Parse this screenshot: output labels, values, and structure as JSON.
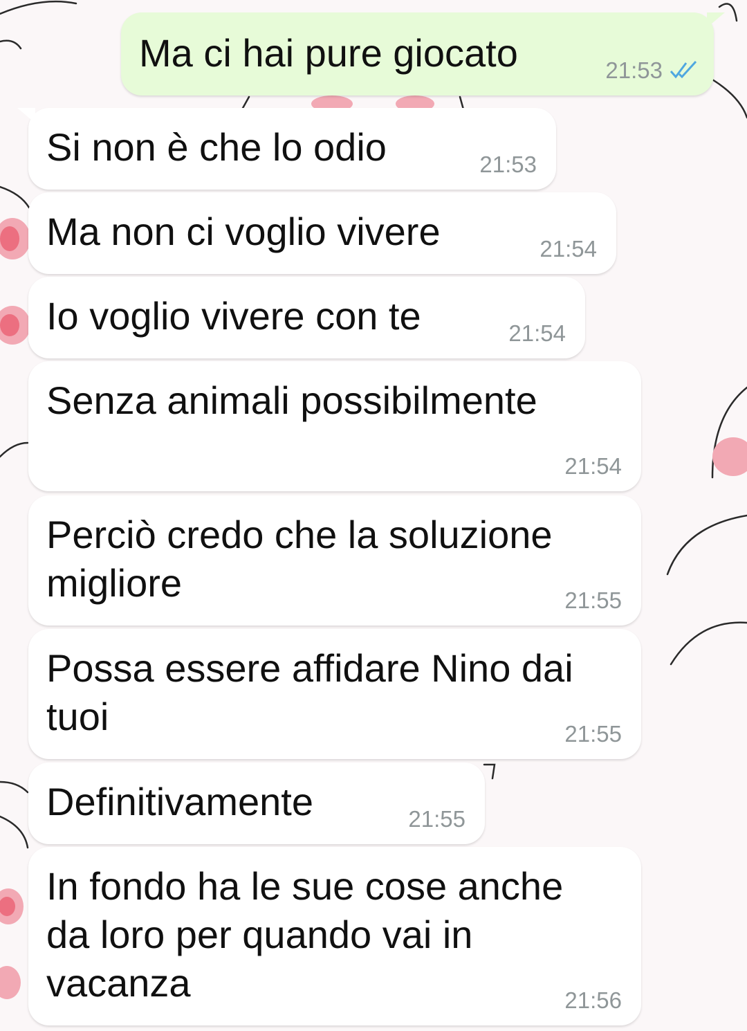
{
  "colors": {
    "incoming_bubble": "#ffffff",
    "outgoing_bubble": "#e7fbd8",
    "time_text": "#8f9698",
    "read_ticks": "#4fa7e0",
    "message_text": "#101010"
  },
  "messages": [
    {
      "direction": "outgoing",
      "text": "Ma ci hai pure giocato",
      "time": "21:53",
      "status": "read-ticks-icon"
    },
    {
      "direction": "incoming",
      "text": "Si non è che lo odio",
      "time": "21:53"
    },
    {
      "direction": "incoming",
      "text": "Ma non ci voglio vivere",
      "time": "21:54"
    },
    {
      "direction": "incoming",
      "text": "Io voglio vivere con te",
      "time": "21:54"
    },
    {
      "direction": "incoming",
      "text": "Senza animali possibilmente",
      "time": "21:54"
    },
    {
      "direction": "incoming",
      "lines": [
        "Perciò credo che la soluzione",
        "migliore"
      ],
      "time": "21:55"
    },
    {
      "direction": "incoming",
      "lines": [
        "Possa essere affidare Nino dai",
        "tuoi"
      ],
      "time": "21:55"
    },
    {
      "direction": "incoming",
      "text": "Definitivamente",
      "time": "21:55"
    },
    {
      "direction": "incoming",
      "lines": [
        "In fondo ha le sue cose anche",
        "da loro per quando vai in",
        "vacanza"
      ],
      "time": "21:56"
    }
  ]
}
